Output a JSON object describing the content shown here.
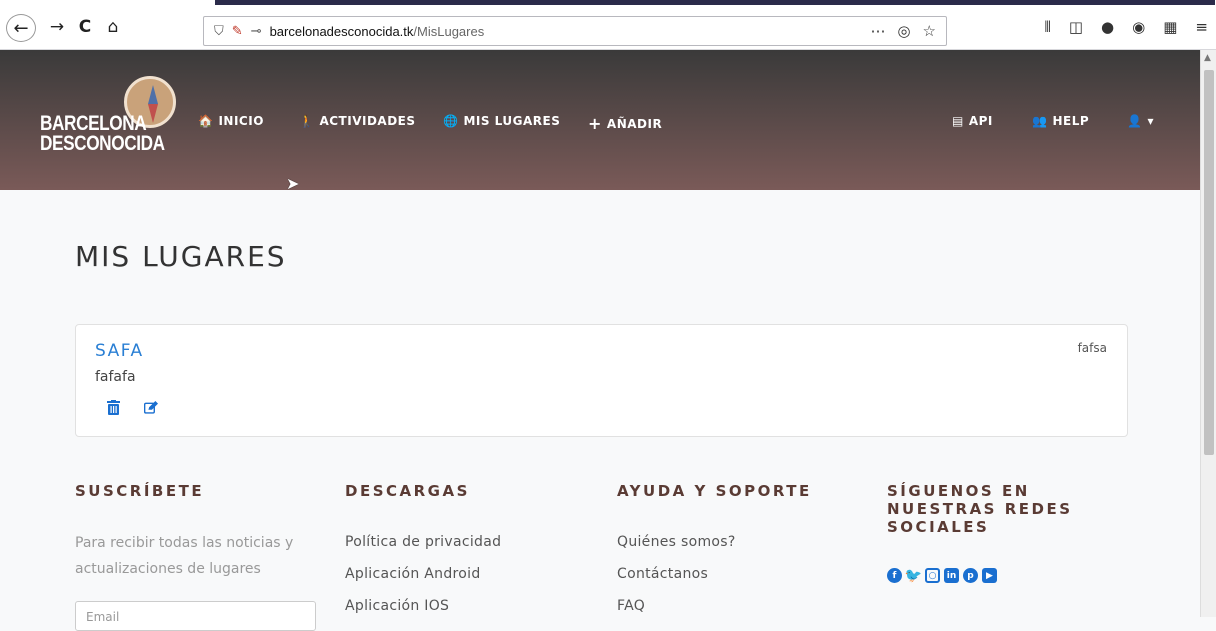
{
  "browser": {
    "url_domain": "barcelonadesconocida.tk",
    "url_path": "/MisLugares",
    "back": "←",
    "forward": "→",
    "reload": "C",
    "home": "⌂"
  },
  "logo": {
    "line1": "BARCELONA",
    "line2": "DESCONOCIDA"
  },
  "nav": {
    "items": [
      {
        "icon": "🏠",
        "label": "INICIO"
      },
      {
        "icon": "🚶",
        "label": "ACTIVIDADES"
      },
      {
        "icon": "🌐",
        "label": "MIS LUGARES"
      },
      {
        "icon": "+",
        "label": "AÑADIR"
      },
      {
        "icon": "▤",
        "label": "API"
      },
      {
        "icon": "👥",
        "label": "HELP"
      }
    ],
    "user_caret": "▾"
  },
  "page": {
    "title": "MIS LUGARES"
  },
  "card": {
    "title": "SAFA",
    "description": "fafafa",
    "meta": "fafsa"
  },
  "footer": {
    "subscribe": {
      "heading": "SUSCRÍBETE",
      "text_line1": "Para recibir todas las noticias y",
      "text_line2": "actualizaciones de lugares",
      "email_placeholder": "Email"
    },
    "downloads": {
      "heading": "DESCARGAS",
      "links": [
        "Política de privacidad",
        "Aplicación Android",
        "Aplicación IOS"
      ]
    },
    "support": {
      "heading": "AYUDA Y SOPORTE",
      "links": [
        "Quiénes somos?",
        "Contáctanos",
        "FAQ"
      ]
    },
    "social": {
      "heading_line1": "SÍGUENOS EN",
      "heading_line2": "NUESTRAS REDES",
      "heading_line3": "SOCIALES",
      "icons": [
        "facebook-icon",
        "twitter-icon",
        "instagram-icon",
        "linkedin-icon",
        "pinterest-icon",
        "youtube-icon"
      ]
    }
  },
  "colors": {
    "accent_blue": "#2a7fd4",
    "footer_heading": "#5a3b34",
    "header_top": "#3a3a3a",
    "header_bottom": "#7a5a58"
  }
}
